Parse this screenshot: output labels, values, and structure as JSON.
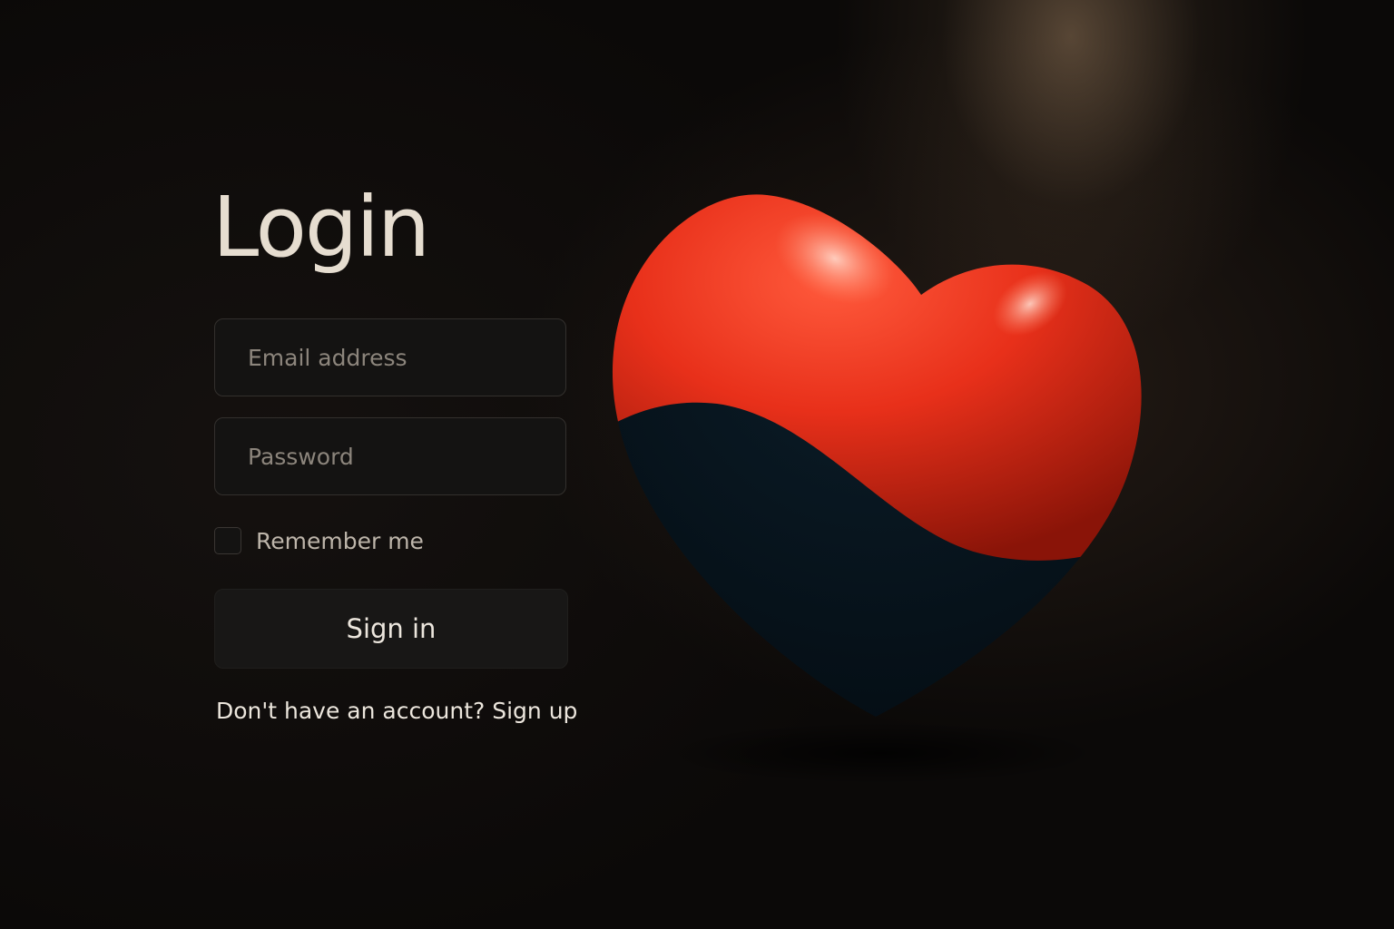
{
  "login": {
    "title": "Login",
    "email_placeholder": "Email address",
    "password_placeholder": "Password",
    "remember_label": "Remember me",
    "signin_label": "Sign in",
    "signup_prompt": "Don't have an account?",
    "signup_link": "Sign up"
  },
  "illustration": {
    "name": "heart-illustration",
    "colors": {
      "top": "#e8301a",
      "bottom": "#06131d",
      "background": "#0b0908"
    }
  },
  "colors": {
    "title": "#e6ddd0",
    "field_background": "#141312",
    "button_background": "#181716"
  }
}
